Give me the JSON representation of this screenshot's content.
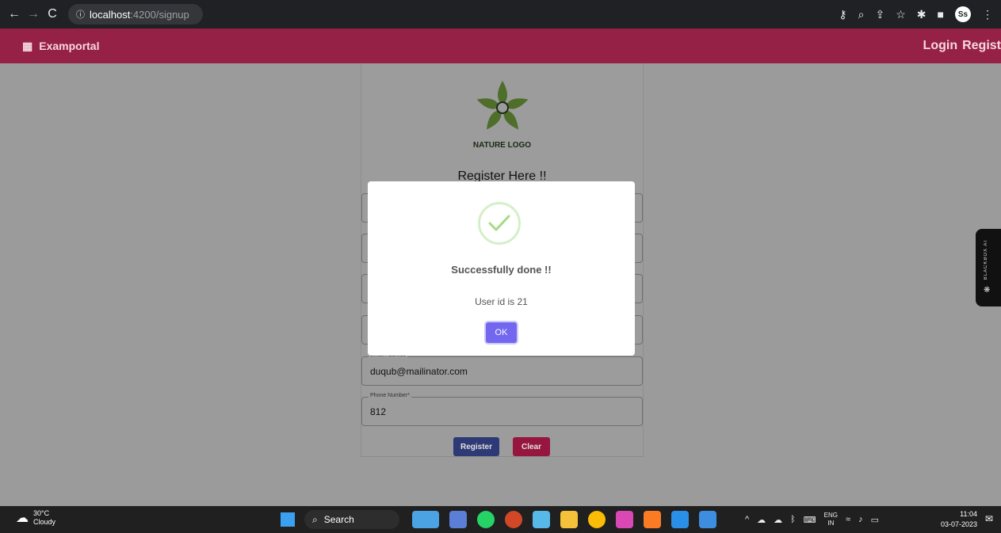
{
  "browser": {
    "url_host": "localhost",
    "url_path": ":4200/signup",
    "profile_initials": "Ss"
  },
  "navbar": {
    "brand": "Examportal",
    "links": [
      "Login",
      "Regist"
    ]
  },
  "card": {
    "logo_text": "NATURE LOGO",
    "title": "Register Here !!",
    "fields": [
      {
        "label": "",
        "value": ""
      },
      {
        "label": "",
        "value": ""
      },
      {
        "label": "",
        "value": ""
      },
      {
        "label": "",
        "value": ""
      },
      {
        "label": "Email Address",
        "value": "duqub@mailinator.com"
      },
      {
        "label": "Phone Number*",
        "value": "812"
      }
    ],
    "register_label": "Register",
    "clear_label": "Clear"
  },
  "modal": {
    "title": "Successfully done !!",
    "message": "User id is 21",
    "ok_label": "OK",
    "check_color": "#a5dc86"
  },
  "side_tab": {
    "label": "BLACKBOX AI"
  },
  "taskbar": {
    "temperature": "30°C",
    "condition": "Cloudy",
    "search_label": "Search",
    "lang_top": "ENG",
    "lang_bottom": "IN",
    "time": "11:04",
    "date": "03-07-2023"
  },
  "colors": {
    "navbar": "#962147",
    "register_button": "#2e3a76",
    "clear_button": "#96163f",
    "ok_button": "#7367f0"
  }
}
